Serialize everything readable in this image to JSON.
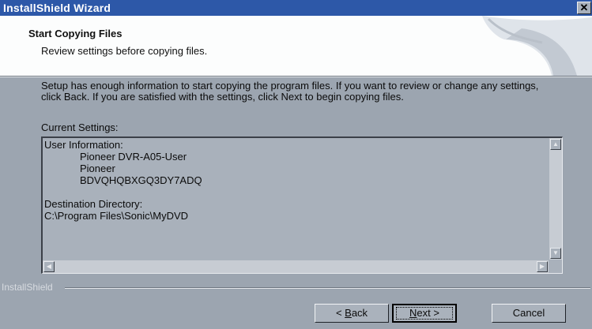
{
  "window": {
    "title": "InstallShield Wizard",
    "close_glyph": "✕",
    "close_icon": "close-icon"
  },
  "header": {
    "title": "Start Copying Files",
    "subtitle": "Review settings before copying files."
  },
  "body": {
    "description": "Setup has enough information to start copying the program files.  If you want to review or change any settings, click Back.  If you are satisfied with the settings, click Next to begin copying files.",
    "current_settings_label": "Current Settings:",
    "settings": {
      "user_info_heading": "User Information:",
      "user_info_lines": [
        "Pioneer DVR-A05-User",
        "Pioneer",
        "BDVQHQBXGQ3DY7ADQ"
      ],
      "destination_heading": "Destination Directory:",
      "destination_path": "C:\\Program Files\\Sonic\\MyDVD"
    },
    "scrollbars": {
      "up_glyph": "▲",
      "down_glyph": "▼",
      "left_glyph": "◀",
      "right_glyph": "▶"
    }
  },
  "footer": {
    "brand": "InstallShield",
    "back_button": {
      "prefix": "< ",
      "mnemonic": "B",
      "rest": "ack"
    },
    "next_button": {
      "mnemonic": "N",
      "rest": "ext >"
    },
    "cancel_button": "Cancel"
  },
  "colors": {
    "titlebar": "#2d58a8",
    "dialog_bg": "#9ca5b0",
    "header_bg": "#fcfdfd",
    "listbox_bg": "#a9b1bb"
  }
}
